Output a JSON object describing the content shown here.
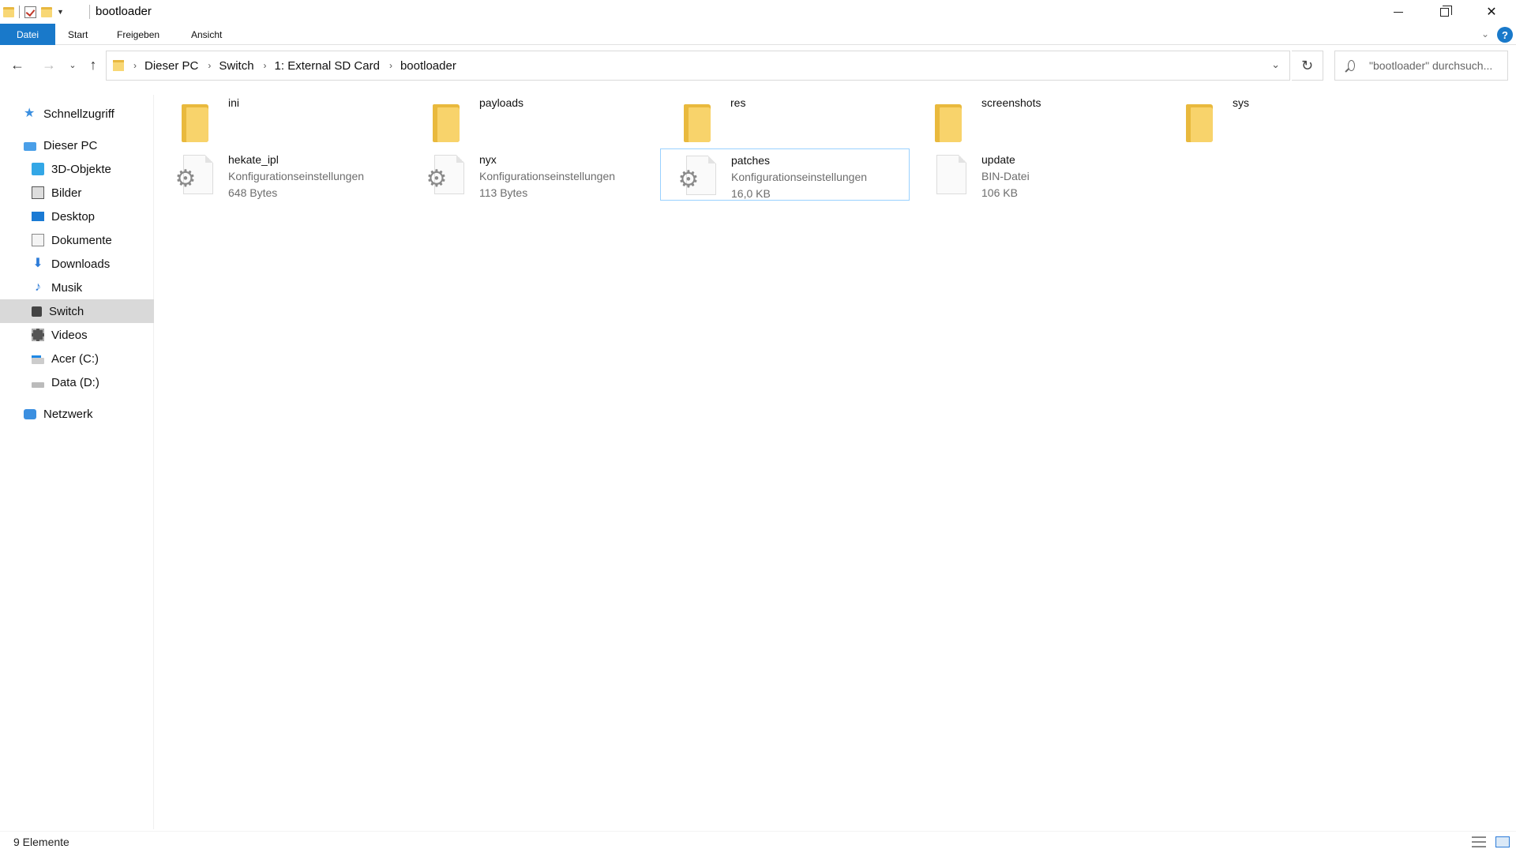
{
  "window": {
    "title": "bootloader"
  },
  "ribbon": {
    "tabs": [
      "Datei",
      "Start",
      "Freigeben",
      "Ansicht"
    ],
    "help_label": "?"
  },
  "address": {
    "crumbs": [
      "Dieser PC",
      "Switch",
      "1: External SD Card",
      "bootloader"
    ]
  },
  "search": {
    "placeholder": "\"bootloader\" durchsuch..."
  },
  "sidebar": {
    "items": [
      {
        "label": "Schnellzugriff",
        "icon": "star-icon"
      },
      {
        "label": "Dieser PC",
        "icon": "computer-icon"
      },
      {
        "label": "3D-Objekte",
        "icon": "3d-objects-icon"
      },
      {
        "label": "Bilder",
        "icon": "pictures-icon"
      },
      {
        "label": "Desktop",
        "icon": "desktop-icon"
      },
      {
        "label": "Dokumente",
        "icon": "documents-icon"
      },
      {
        "label": "Downloads",
        "icon": "download-icon"
      },
      {
        "label": "Musik",
        "icon": "music-icon"
      },
      {
        "label": "Switch",
        "icon": "device-icon",
        "selected": true
      },
      {
        "label": "Videos",
        "icon": "videos-icon"
      },
      {
        "label": "Acer (C:)",
        "icon": "drive-c-icon"
      },
      {
        "label": "Data (D:)",
        "icon": "drive-d-icon"
      },
      {
        "label": "Netzwerk",
        "icon": "network-icon"
      }
    ]
  },
  "content": {
    "folders": [
      {
        "name": "ini"
      },
      {
        "name": "payloads"
      },
      {
        "name": "res"
      },
      {
        "name": "screenshots"
      },
      {
        "name": "sys"
      }
    ],
    "files": [
      {
        "name": "hekate_ipl",
        "type": "Konfigurationseinstellungen",
        "size": "648 Bytes",
        "icon": "settings-file-icon"
      },
      {
        "name": "nyx",
        "type": "Konfigurationseinstellungen",
        "size": "113 Bytes",
        "icon": "settings-file-icon"
      },
      {
        "name": "patches",
        "type": "Konfigurationseinstellungen",
        "size": "16,0 KB",
        "icon": "settings-file-icon",
        "selected": true
      },
      {
        "name": "update",
        "type": "BIN-Datei",
        "size": "106 KB",
        "icon": "blank-file-icon"
      }
    ]
  },
  "status": {
    "item_count": "9 Elemente"
  },
  "colors": {
    "accent": "#1979ca",
    "selection_border": "#99d1ff",
    "sidebar_selected": "#d9d9d9",
    "folder": "#f8d36b"
  }
}
